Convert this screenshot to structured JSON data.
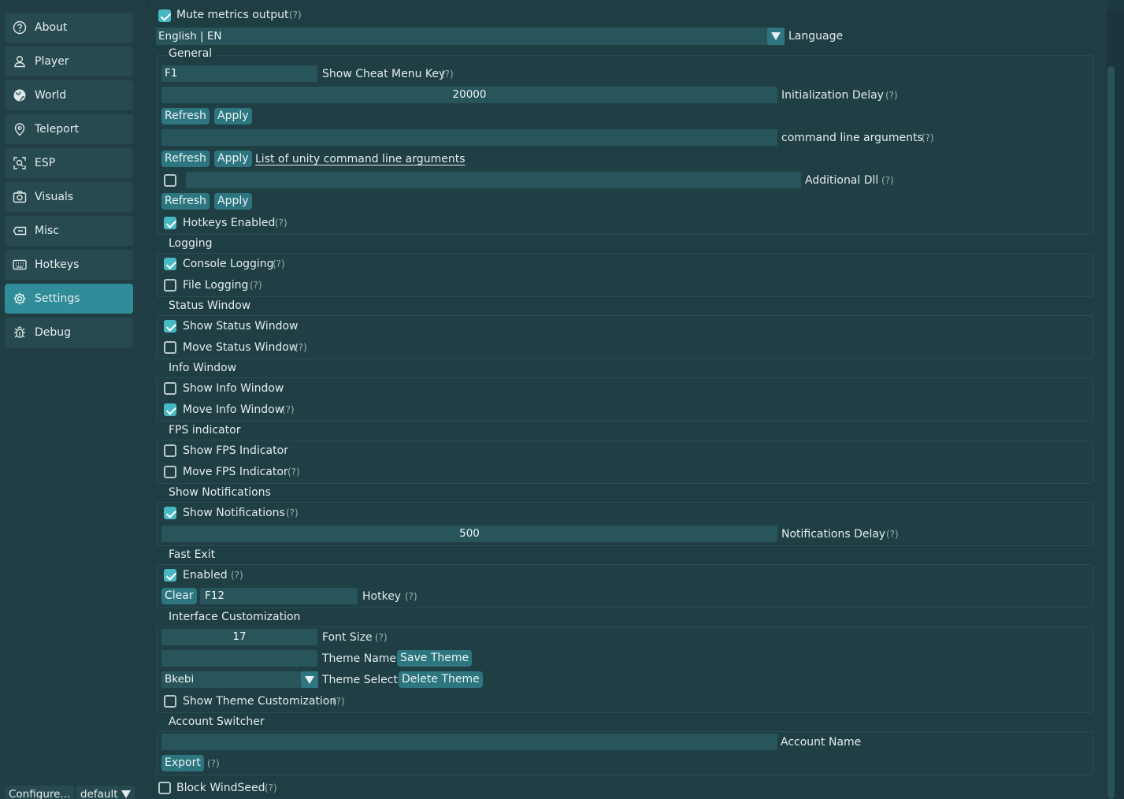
{
  "sidebar": {
    "items": [
      {
        "label": "About",
        "icon": "help-circle-icon"
      },
      {
        "label": "Player",
        "icon": "user-icon"
      },
      {
        "label": "World",
        "icon": "globe-icon"
      },
      {
        "label": "Teleport",
        "icon": "map-pin-icon"
      },
      {
        "label": "ESP",
        "icon": "scan-icon"
      },
      {
        "label": "Visuals",
        "icon": "camera-icon"
      },
      {
        "label": "Misc",
        "icon": "ticket-icon"
      },
      {
        "label": "Hotkeys",
        "icon": "keyboard-icon"
      },
      {
        "label": "Settings",
        "icon": "gear-icon",
        "active": true
      },
      {
        "label": "Debug",
        "icon": "bug-icon"
      }
    ],
    "footer": {
      "configure": "Configure...",
      "profile": "default"
    }
  },
  "colors": {
    "accent": "#2f8c98",
    "checkbox": "#48b8c4",
    "button": "#2d7680",
    "field": "#28555c"
  },
  "top": {
    "mute_metrics": "Mute metrics output",
    "language_value": "English | EN",
    "language_label": "Language"
  },
  "help": "(?)",
  "general": {
    "title": "General",
    "cheat_key_value": "F1",
    "cheat_key_label": "Show Cheat Menu Key",
    "init_delay_value": "20000",
    "init_delay_label": "Initialization Delay",
    "refresh": "Refresh",
    "apply": "Apply",
    "cmd_args_value": "",
    "cmd_args_label": "command line arguments",
    "cmd_args_link": "List of unity command line arguments",
    "additional_dll_value": "",
    "additional_dll_label": "Additional Dll",
    "hotkeys_enabled": "Hotkeys Enabled"
  },
  "logging": {
    "title": "Logging",
    "console": "Console Logging",
    "file": "File Logging"
  },
  "status_window": {
    "title": "Status Window",
    "show": "Show Status Window",
    "move": "Move Status Window"
  },
  "info_window": {
    "title": "Info Window",
    "show": "Show Info Window",
    "move": "Move Info Window"
  },
  "fps": {
    "title": "FPS indicator",
    "show": "Show FPS Indicator",
    "move": "Move FPS Indicator"
  },
  "notifications": {
    "title": "Show Notifications",
    "show": "Show Notifications",
    "delay_value": "500",
    "delay_label": "Notifications Delay"
  },
  "fast_exit": {
    "title": "Fast Exit",
    "enabled": "Enabled",
    "clear": "Clear",
    "hotkey_value": "F12",
    "hotkey_label": "Hotkey"
  },
  "interface": {
    "title": "Interface Customization",
    "font_size_value": "17",
    "font_size_label": "Font Size",
    "theme_name_value": "",
    "theme_name_label": "Theme Name",
    "save_theme": "Save Theme",
    "theme_select_value": "Bkebi",
    "theme_select_label": "Theme Select",
    "delete_theme": "Delete Theme",
    "show_customization": "Show Theme Customization"
  },
  "account": {
    "title": "Account Switcher",
    "name_value": "",
    "name_label": "Account Name",
    "export": "Export"
  },
  "block_windseed": "Block WindSeed"
}
